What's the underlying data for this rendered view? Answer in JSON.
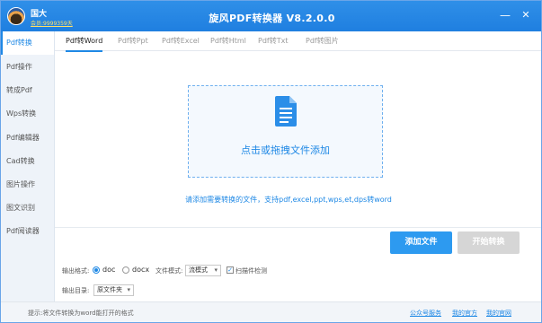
{
  "user": {
    "name": "国大",
    "vip": "会员:9999359天"
  },
  "app": {
    "title": "旋风PDF转换器 V8.2.0.0"
  },
  "window_controls": {
    "minimize": "—",
    "close": "✕"
  },
  "sidebar": {
    "items": [
      {
        "label": "Pdf转换",
        "active": true
      },
      {
        "label": "Pdf操作"
      },
      {
        "label": "转成Pdf"
      },
      {
        "label": "Wps转换"
      },
      {
        "label": "Pdf编辑器"
      },
      {
        "label": "Cad转换"
      },
      {
        "label": "图片操作"
      },
      {
        "label": "图文识别"
      },
      {
        "label": "Pdf阅读器"
      }
    ]
  },
  "tabs": [
    {
      "label": "Pdf转Word",
      "active": true
    },
    {
      "label": "Pdf转Ppt"
    },
    {
      "label": "Pdf转Excel"
    },
    {
      "label": "Pdf转Html"
    },
    {
      "label": "Pdf转Txt"
    },
    {
      "label": "Pdf转图片"
    }
  ],
  "dropzone": {
    "icon": "document-icon",
    "text": "点击或拖拽文件添加"
  },
  "hint": "请添加需要转换的文件，支持pdf,excel,ppt,wps,et,dps转word",
  "actions": {
    "add_file": "添加文件",
    "start_convert": "开始转换"
  },
  "options": {
    "output_format_label": "输出格式:",
    "format_doc": "doc",
    "format_docx": "docx",
    "selected_format": "doc",
    "file_mode_label": "文件模式:",
    "file_mode_value": "流模式",
    "scan_check_label": "扫描件检测",
    "scan_check_checked": true,
    "output_dir_label": "输出目录:",
    "output_dir_value": "原文件夹"
  },
  "status": {
    "text": "提示:将文件转换为word能打开的格式",
    "links": [
      "公众号服务",
      "我的官方",
      "我的官网"
    ]
  },
  "colors": {
    "accent": "#1e88e5",
    "titlebar": "#2f8fe8",
    "add_button": "#2d9af0",
    "disabled_button": "#d6d6d6"
  }
}
